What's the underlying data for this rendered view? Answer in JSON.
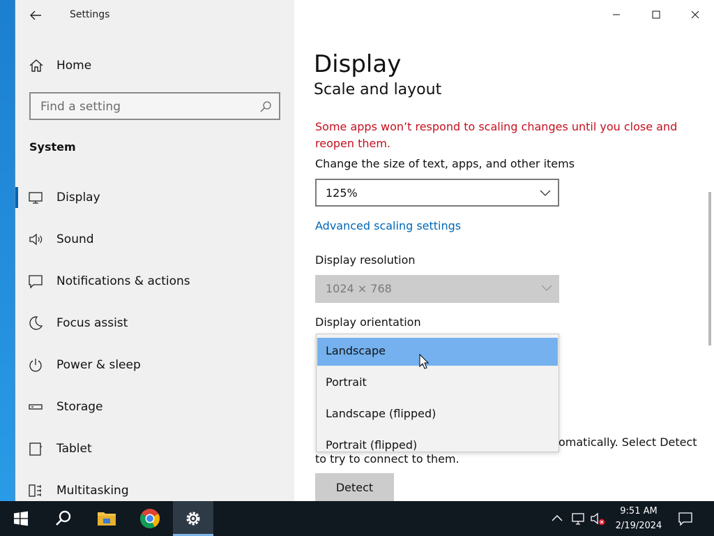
{
  "window": {
    "title": "Settings",
    "controls": {
      "minimize": "minimize",
      "maximize": "maximize",
      "close": "close"
    }
  },
  "sidebar": {
    "home_label": "Home",
    "search_placeholder": "Find a setting",
    "section_header": "System",
    "items": [
      {
        "label": "Display",
        "icon": "monitor-icon",
        "active": true
      },
      {
        "label": "Sound",
        "icon": "speaker-icon",
        "active": false
      },
      {
        "label": "Notifications & actions",
        "icon": "message-icon",
        "active": false
      },
      {
        "label": "Focus assist",
        "icon": "moon-icon",
        "active": false
      },
      {
        "label": "Power & sleep",
        "icon": "power-icon",
        "active": false
      },
      {
        "label": "Storage",
        "icon": "storage-icon",
        "active": false
      },
      {
        "label": "Tablet",
        "icon": "tablet-icon",
        "active": false
      },
      {
        "label": "Multitasking",
        "icon": "multitasking-icon",
        "active": false
      }
    ]
  },
  "main": {
    "page_title": "Display",
    "section_title": "Scale and layout",
    "warning": "Some apps won’t respond to scaling changes until you close and reopen them.",
    "scale_label": "Change the size of text, apps, and other items",
    "scale_value": "125%",
    "advanced_link": "Advanced scaling settings",
    "resolution_label": "Display resolution",
    "resolution_value": "1024 × 768",
    "orientation_label": "Display orientation",
    "orientation_options": [
      "Landscape",
      "Portrait",
      "Landscape (flipped)",
      "Portrait (flipped)"
    ],
    "orientation_selected": "Landscape",
    "detect_text": "Older displays might not always connect automatically. Select Detect to try to connect to them.",
    "detect_text_visible": "omatically. Select Detect",
    "detect_text_line2": "to try to connect to them.",
    "detect_button": "Detect"
  },
  "taskbar": {
    "apps": [
      "start-button",
      "search-button",
      "file-explorer",
      "chrome",
      "settings"
    ],
    "clock_time": "9:51 AM",
    "clock_date": "2/19/2024"
  },
  "colors": {
    "accent": "#0063b1",
    "link": "#0067b8",
    "warning": "#c50f1f",
    "selected_item": "#74b1ee",
    "taskbar": "#101820"
  }
}
